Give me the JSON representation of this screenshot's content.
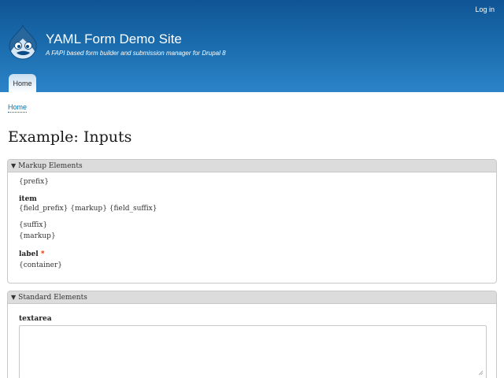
{
  "header": {
    "login_label": "Log in",
    "site_name": "YAML Form Demo Site",
    "slogan": "A FAPI based form builder and submission manager for Drupal 8",
    "logo_icon": "drupal-drop-icon",
    "tabs": [
      {
        "label": "Home"
      }
    ]
  },
  "breadcrumb": {
    "items": [
      {
        "label": "Home"
      }
    ]
  },
  "page": {
    "title": "Example: Inputs"
  },
  "markup_section": {
    "legend": "Markup Elements",
    "prefix": "{prefix}",
    "item_label": "item",
    "item_content": "{field_prefix} {markup} {field_suffix}",
    "suffix": "{suffix}",
    "markup": "{markup}",
    "label_text": "label",
    "required_mark": "*",
    "container": "{container}"
  },
  "standard_section": {
    "legend": "Standard Elements",
    "textarea_label": "textarea",
    "textarea_value": ""
  },
  "colors": {
    "header_top": "#0f5595",
    "header_bottom": "#2c83c8",
    "link": "#0071b3",
    "required": "#e32700"
  }
}
